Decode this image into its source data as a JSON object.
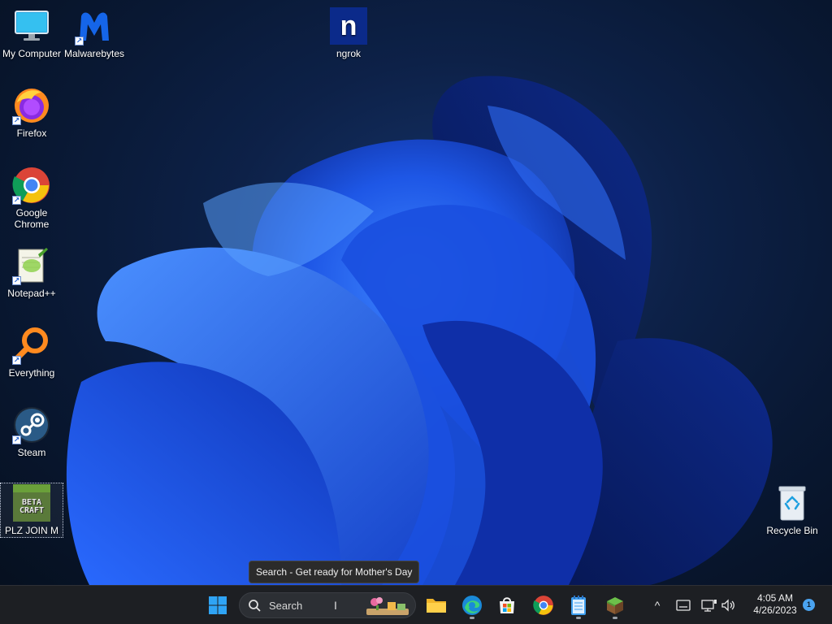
{
  "desktop": {
    "icons": [
      {
        "label": "My Computer"
      },
      {
        "label": "Malwarebytes"
      },
      {
        "label": "ngrok"
      },
      {
        "label": "Firefox"
      },
      {
        "label": "Google Chrome"
      },
      {
        "label": "Notepad++"
      },
      {
        "label": "Everything"
      },
      {
        "label": "Steam"
      },
      {
        "label": "PLZ JOIN M"
      },
      {
        "label": "Recycle Bin"
      }
    ],
    "ngrok_glyph": "n",
    "betacraft_glyph": "BETA CRAFT",
    "shortcut_glyph": "↗"
  },
  "tooltip": {
    "text": "Search - Get ready for Mother's Day"
  },
  "taskbar": {
    "search_label": "Search",
    "tray_chevron": "^",
    "clock_time": "4:05 AM",
    "clock_date": "4/26/2023",
    "notification_count": "1"
  },
  "colors": {
    "accent": "#1e6ff0",
    "taskbar_bg": "#1d1f23",
    "wallpaper_dark": "#091833"
  }
}
